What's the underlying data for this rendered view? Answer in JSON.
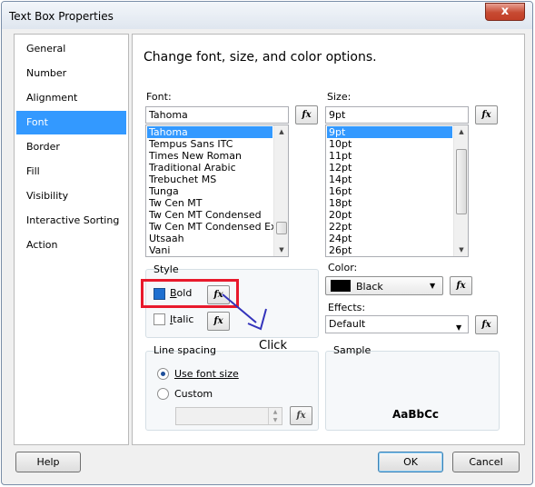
{
  "window": {
    "title": "Text Box Properties",
    "close_glyph": "x"
  },
  "nav": {
    "items": [
      {
        "label": "General",
        "selected": false
      },
      {
        "label": "Number",
        "selected": false
      },
      {
        "label": "Alignment",
        "selected": false
      },
      {
        "label": "Font",
        "selected": true
      },
      {
        "label": "Border",
        "selected": false
      },
      {
        "label": "Fill",
        "selected": false
      },
      {
        "label": "Visibility",
        "selected": false
      },
      {
        "label": "Interactive Sorting",
        "selected": false
      },
      {
        "label": "Action",
        "selected": false
      }
    ]
  },
  "heading": "Change font, size, and color options.",
  "font": {
    "label": "Font:",
    "value": "Tahoma",
    "fx_glyph": "fx",
    "list": [
      "Tahoma",
      "Tempus Sans ITC",
      "Times New Roman",
      "Traditional Arabic",
      "Trebuchet MS",
      "Tunga",
      "Tw Cen MT",
      "Tw Cen MT Condensed",
      "Tw Cen MT Condensed Ext",
      "Utsaah",
      "Vani"
    ],
    "selected": "Tahoma"
  },
  "size": {
    "label": "Size:",
    "value": "9pt",
    "list": [
      "9pt",
      "10pt",
      "11pt",
      "12pt",
      "14pt",
      "16pt",
      "18pt",
      "20pt",
      "22pt",
      "24pt",
      "26pt"
    ],
    "selected": "9pt"
  },
  "style": {
    "group_label": "Style",
    "bold_label": "Bold",
    "italic_label": "Italic",
    "bold_checked": true,
    "italic_checked": false
  },
  "annotation": {
    "text": "Click",
    "highlight_color": "#e8192c",
    "arrow_color": "#3333bb"
  },
  "color": {
    "label": "Color:",
    "value": "Black",
    "swatch": "#000000"
  },
  "effects": {
    "label": "Effects:",
    "value": "Default"
  },
  "line_spacing": {
    "group_label": "Line spacing",
    "use_font_size_label": "Use font size",
    "custom_label": "Custom",
    "selected": "use_font_size",
    "custom_value": ""
  },
  "sample": {
    "group_label": "Sample",
    "text": "AaBbCc"
  },
  "buttons": {
    "help": "Help",
    "ok": "OK",
    "cancel": "Cancel"
  },
  "accent_color": "#3399ff"
}
